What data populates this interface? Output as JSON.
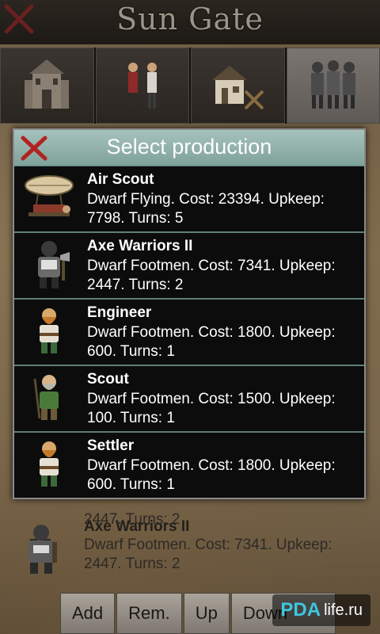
{
  "title": "Sun Gate",
  "tabs": [
    {
      "icon": "castle-icon",
      "active": false
    },
    {
      "icon": "citizens-icon",
      "active": false
    },
    {
      "icon": "buildings-icon",
      "active": false
    },
    {
      "icon": "army-units-icon",
      "active": true
    }
  ],
  "background_list": [
    {
      "name": "",
      "desc": "2447. Turns: 2"
    },
    {
      "name": "Axe Warriors II",
      "desc": "Dwarf Footmen. Cost: 7341. Upkeep: 2447. Turns: 2"
    }
  ],
  "dialog": {
    "title": "Select production",
    "items": [
      {
        "name": "Air Scout",
        "desc": "Dwarf Flying. Cost: 23394. Upkeep: 7798. Turns: 5",
        "icon": "airship-icon"
      },
      {
        "name": "Axe Warriors II",
        "desc": "Dwarf Footmen. Cost: 7341. Upkeep: 2447. Turns: 2",
        "icon": "armored-dwarf-icon"
      },
      {
        "name": "Engineer",
        "desc": "Dwarf Footmen. Cost: 1800. Upkeep: 600. Turns: 1",
        "icon": "dwarf-engineer-icon"
      },
      {
        "name": "Scout",
        "desc": "Dwarf Footmen. Cost: 1500. Upkeep: 100. Turns: 1",
        "icon": "dwarf-scout-icon"
      },
      {
        "name": "Settler",
        "desc": "Dwarf Footmen. Cost: 1800. Upkeep: 600. Turns: 1",
        "icon": "dwarf-settler-icon"
      }
    ]
  },
  "buttons": {
    "add": "Add",
    "remove": "Rem.",
    "up": "Up",
    "down": "Down"
  },
  "watermark": {
    "logo": "PDA",
    "text": "life.ru"
  },
  "colors": {
    "dialog_header": "#8fb1a9",
    "dialog_bg": "#0c0c0c",
    "close_x": "#b32222"
  }
}
